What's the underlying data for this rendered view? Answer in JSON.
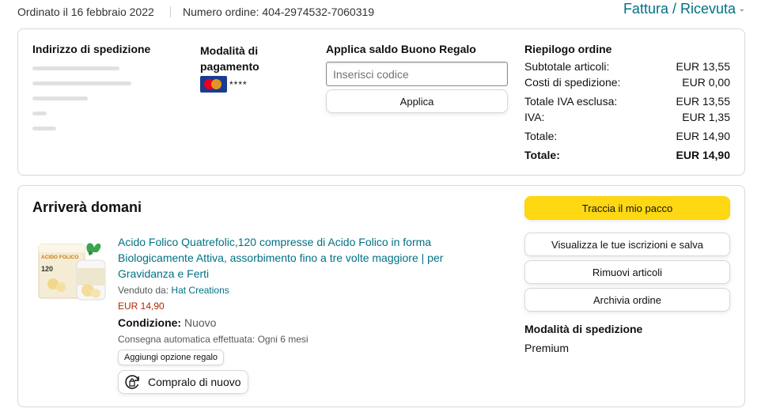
{
  "header": {
    "order_date": "Ordinato il 16 febbraio 2022",
    "order_number": "Numero ordine: 404-2974532-7060319",
    "invoice_link": "Fattura / Ricevuta"
  },
  "shipping_address": {
    "title": "Indirizzo di spedizione"
  },
  "payment": {
    "title": "Modalità di pagamento",
    "card_mask": "****"
  },
  "gift_card": {
    "title": "Applica saldo Buono Regalo",
    "input_placeholder": "Inserisci codice",
    "input_value": "",
    "apply_label": "Applica"
  },
  "summary": {
    "title": "Riepilogo ordine",
    "rows": [
      {
        "label": "Subtotale articoli:",
        "value": "EUR 13,55"
      },
      {
        "label": "Costi di spedizione:",
        "value": "EUR 0,00"
      },
      {
        "label": "Totale IVA esclusa:",
        "value": "EUR 13,55"
      },
      {
        "label": "IVA:",
        "value": "EUR 1,35"
      },
      {
        "label": "Totale:",
        "value": "EUR 14,90"
      }
    ],
    "grand_total_label": "Totale:",
    "grand_total_value": "EUR 14,90"
  },
  "shipment": {
    "status": "Arriverà domani",
    "track_label": "Traccia il mio pacco",
    "subscribe_label": "Visualizza le tue iscrizioni e salva",
    "remove_label": "Rimuovi articoli",
    "archive_label": "Archivia ordine",
    "shipping_method_title": "Modalità di spedizione",
    "shipping_method_value": "Premium"
  },
  "product": {
    "title": "Acido Folico Quatrefolic,120 compresse di Acido Folico in forma Biologicamente Attiva, assorbimento fino a tre volte maggiore | per Gravidanza e Ferti",
    "sold_by_label": "Venduto da:",
    "seller": "Hat Creations",
    "price": "EUR 14,90",
    "condition_label": "Condizione:",
    "condition_value": "Nuovo",
    "auto_delivery": "Consegna automatica effettuata: Ogni 6 mesi",
    "gift_option_label": "Aggiungi opzione regalo",
    "buy_again_label": "Compralo di nuovo",
    "image_box_text": "ACIDO FOLICO",
    "image_box_number": "120"
  },
  "colors": {
    "link": "#007185",
    "price": "#b12704",
    "primary_button": "#ffd814",
    "border": "#d5d9d9"
  }
}
